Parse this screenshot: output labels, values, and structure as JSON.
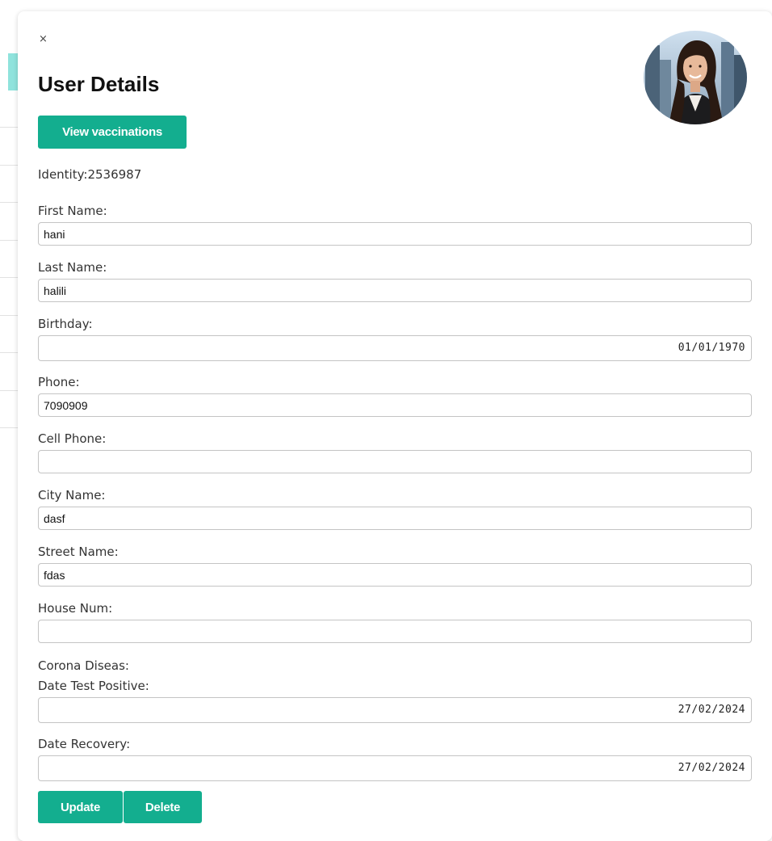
{
  "modal": {
    "close_symbol": "×",
    "title": "User Details",
    "avatar": "user-photo",
    "view_vaccinations_label": "View vaccinations",
    "identity": "Identity:2536987"
  },
  "fields": {
    "first_name": {
      "label": "First Name:",
      "value": "hani"
    },
    "last_name": {
      "label": "Last Name:",
      "value": "halili"
    },
    "birthday": {
      "label": "Birthday:",
      "value": "01/01/1970"
    },
    "phone": {
      "label": "Phone:",
      "value": "7090909"
    },
    "cell_phone": {
      "label": "Cell Phone:",
      "value": ""
    },
    "city_name": {
      "label": "City Name:",
      "value": "dasf"
    },
    "street_name": {
      "label": "Street Name:",
      "value": "fdas"
    },
    "house_num": {
      "label": "House Num:",
      "value": ""
    }
  },
  "corona": {
    "heading": "Corona Diseas:",
    "date_test_positive": {
      "label": "Date Test Positive:",
      "value": "27/02/2024"
    },
    "date_recovery": {
      "label": "Date Recovery:",
      "value": "27/02/2024"
    }
  },
  "actions": {
    "update_label": "Update",
    "delete_label": "Delete"
  },
  "colors": {
    "accent": "#13ae8f",
    "background_accent": "#8fe3dc"
  }
}
